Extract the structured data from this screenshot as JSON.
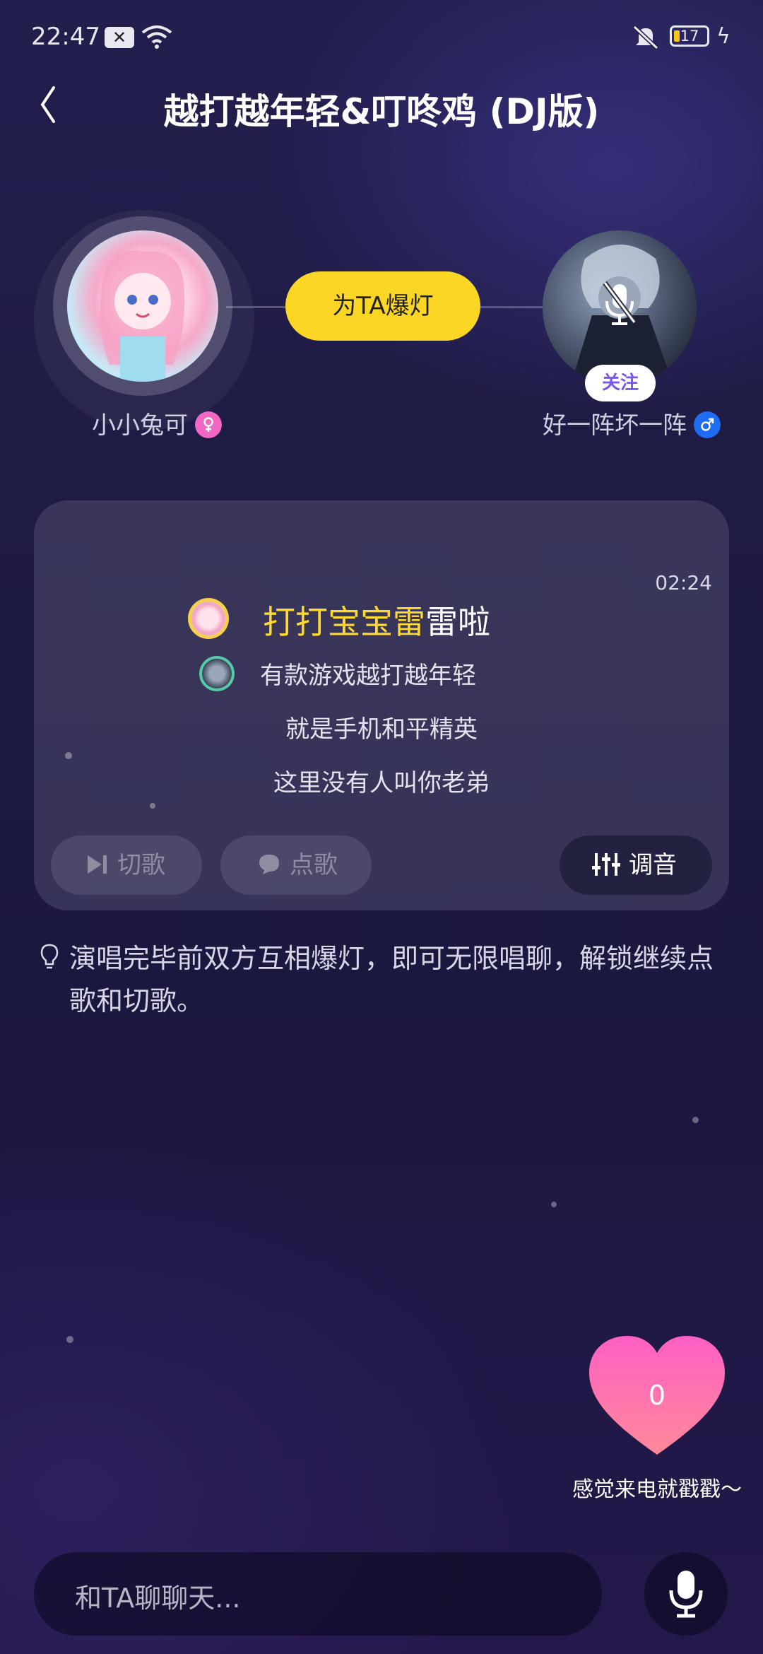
{
  "status_bar": {
    "time": "22:47",
    "battery": "17"
  },
  "header": {
    "title": "越打越年轻&叮咚鸡 (DJ版)"
  },
  "players": {
    "left": {
      "name": "小小兔可",
      "gender": "female"
    },
    "right": {
      "name": "好一阵坏一阵",
      "gender": "male",
      "follow_label": "关注"
    },
    "boom_label": "为TA爆灯"
  },
  "lyrics": {
    "timer": "02:24",
    "current_highlight": "打打宝宝雷",
    "current_rest": "雷啦",
    "line2": "有款游戏越打越年轻",
    "line3": "就是手机和平精英",
    "line4": "这里没有人叫你老弟"
  },
  "controls": {
    "switch_song": "切歌",
    "request_song": "点歌",
    "tune": "调音"
  },
  "tip": "演唱完毕前双方互相爆灯，即可无限唱聊，解锁继续点歌和切歌。",
  "heart": {
    "count": "0",
    "caption": "感觉来电就戳戳～"
  },
  "chat": {
    "placeholder": "和TA聊聊天..."
  },
  "colors": {
    "accent_yellow": "#fbd624",
    "highlight_lyric": "#ffd92e",
    "heart_pink": "#ff5fae",
    "follow_purple": "#7a55e8"
  }
}
